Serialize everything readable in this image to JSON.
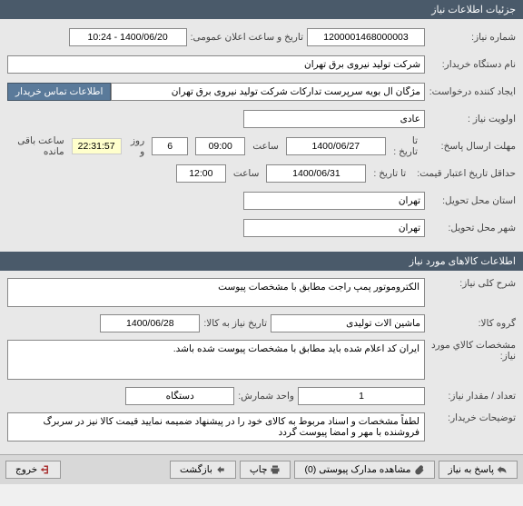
{
  "sections": {
    "need_details": "جزئیات اطلاعات نیاز",
    "goods_info": "اطلاعات کالاهای مورد نیاز"
  },
  "labels": {
    "need_number": "شماره نیاز:",
    "public_announce": "تاریخ و ساعت اعلان عمومی:",
    "buyer_name": "نام دستگاه خریدار:",
    "request_creator": "ایجاد کننده درخواست:",
    "need_priority": "اولویت نیاز :",
    "response_deadline": "مهلت ارسال پاسخ:",
    "to_date": "تا تاریخ :",
    "hour": "ساعت",
    "days_and": "روز و",
    "remaining": "ساعت باقی مانده",
    "price_validity": "حداقل تاریخ اعتبار قیمت:",
    "to_date2": "تا تاریخ :",
    "delivery_province": "استان محل تحویل:",
    "delivery_city": "شهر محل تحویل:",
    "need_description": "شرح کلی نیاز:",
    "goods_group": "گروه کالا:",
    "need_date": "تاریخ نیاز به کالا:",
    "goods_spec": "مشخصات كالاي مورد نياز:",
    "count_amount": "تعداد / مقدار نیاز:",
    "count_unit": "واحد شمارش:",
    "buyer_notes": "توضیحات خریدار:",
    "contact_buyer": "اطلاعات تماس خریدار"
  },
  "values": {
    "need_number": "1200001468000003",
    "public_announce": "1400/06/20 - 10:24",
    "buyer_name": "شرکت تولید نیروی برق تهران",
    "request_creator": "مژگان آل بویه سرپرست تدارکات شرکت تولید نیروی برق تهران",
    "need_priority": "عادی",
    "response_date": "1400/06/27",
    "response_time": "09:00",
    "days_remaining": "6",
    "time_remaining": "22:31:57",
    "price_validity_date": "1400/06/31",
    "price_validity_time": "12:00",
    "delivery_province": "تهران",
    "delivery_city": "تهران",
    "need_description": "الکتروموتور پمپ راجت مطابق با مشخصات پیوست",
    "goods_group": "ماشین آلات تولیدی",
    "need_date": "1400/06/28",
    "goods_spec": "ایران کد اعلام شده باید مطابق با مشخصات پیوست شده باشد.",
    "count": "1",
    "unit": "دستگاه",
    "buyer_notes": "لطفاً مشخصات و اسناد مربوط به کالای خود را در پیشنهاد ضمیمه نمایید قیمت کالا نیز در سربرگ فروشنده با مهر و امضا پیوست گردد"
  },
  "footer": {
    "respond": "پاسخ به نیاز",
    "view_attachments": "مشاهده مدارک پیوستی (0)",
    "print": "چاپ",
    "back": "بازگشت",
    "exit": "خروج"
  }
}
